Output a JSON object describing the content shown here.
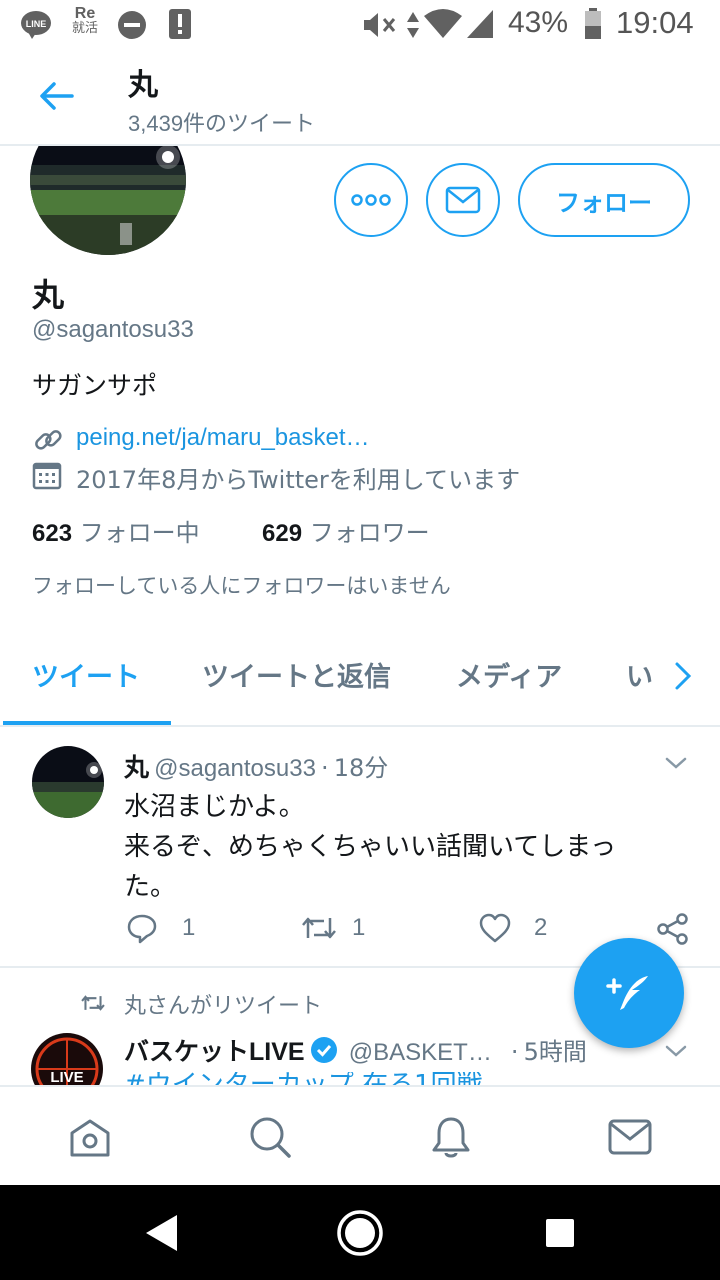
{
  "status_bar": {
    "app_icons": [
      "line-icon",
      "re-icon",
      "minus-circle-icon",
      "alert-icon"
    ],
    "line_label": "LINE",
    "re_label_top": "Re",
    "re_label_bottom": "就活",
    "battery": "43%",
    "time": "19:04"
  },
  "header": {
    "title": "丸",
    "subtitle": "3,439件のツイート"
  },
  "profile": {
    "name": "丸",
    "handle": "@sagantosu33",
    "bio": "サガンサポ",
    "link": "peing.net/ja/maru_basket…",
    "joined": "2017年8月からTwitterを利用しています",
    "following_count": "623",
    "following_label": "フォロー中",
    "followers_count": "629",
    "followers_label": "フォロワー",
    "notice": "フォローしている人にフォロワーはいません",
    "follow_button": "フォロー"
  },
  "tabs": [
    {
      "label": "ツイート",
      "active": true
    },
    {
      "label": "ツイートと返信",
      "active": false
    },
    {
      "label": "メディア",
      "active": false
    },
    {
      "label": "い",
      "active": false
    }
  ],
  "tweet1": {
    "name": "丸",
    "handle": "@sagantosu33",
    "sep": "·",
    "time": "18分",
    "text_line1": "水沼まじかよ。",
    "text_line2": "来るぞ、めちゃくちゃいい話聞いてしまっ",
    "text_line3": "た。",
    "replies": "1",
    "retweets": "1",
    "likes": "2"
  },
  "tweet2": {
    "retweet_label": "丸さんがリツイート",
    "name": "バスケットLIVE",
    "handle": "@BASKET…",
    "sep": "·",
    "time": "5時間",
    "avatar_text": "LIVE",
    "text_partial": "#ウインターカップ 在る1回戦"
  },
  "colors": {
    "accent": "#1da1f2",
    "text": "#14171a",
    "muted": "#657786",
    "border": "#e6ecf0"
  }
}
